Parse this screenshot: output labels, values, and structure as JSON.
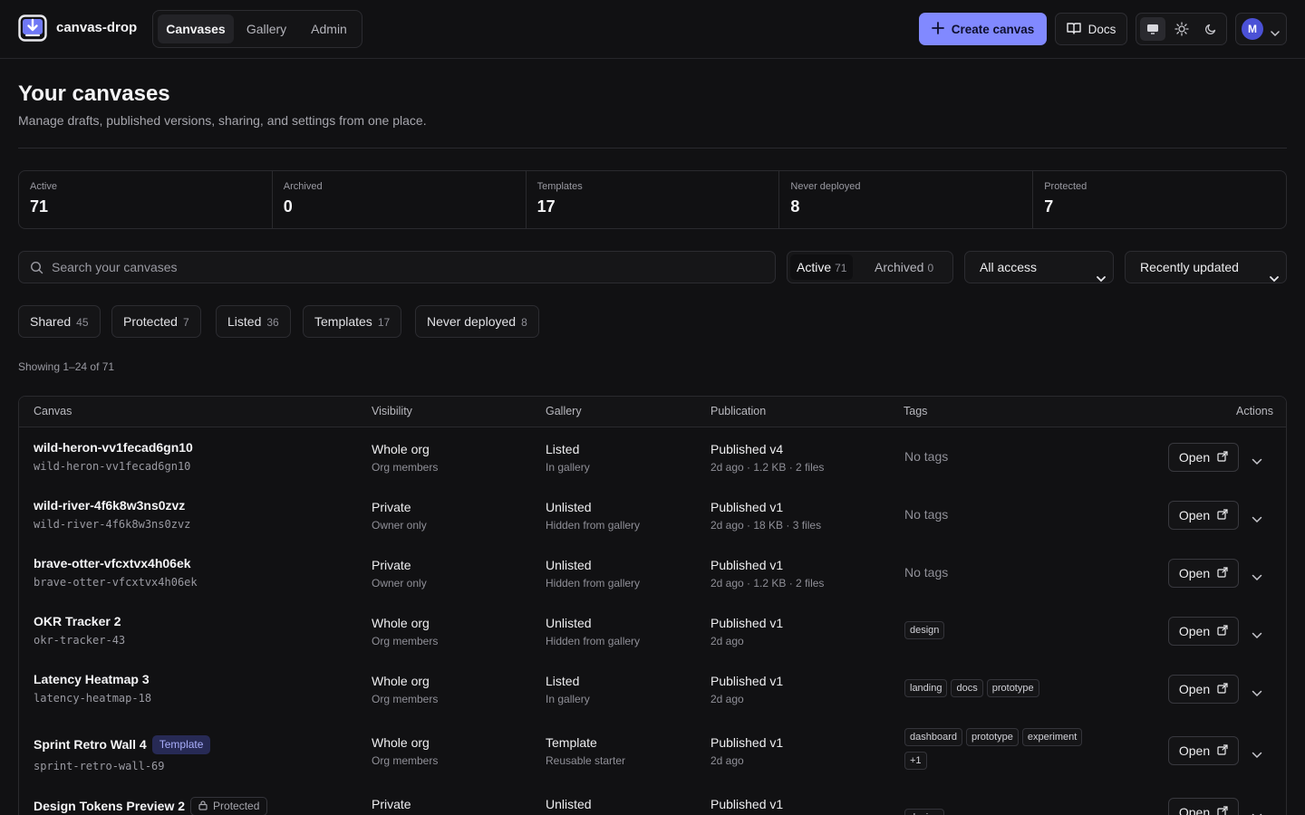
{
  "app": {
    "brand": "canvas-drop",
    "nav": [
      "Canvases",
      "Gallery",
      "Admin"
    ],
    "create_label": "Create canvas",
    "docs_label": "Docs",
    "avatar_initial": "M",
    "accent": "#8189ff"
  },
  "header": {
    "title": "Your canvases",
    "subtitle": "Manage drafts, published versions, sharing, and settings from one place."
  },
  "stats": [
    {
      "label": "Active",
      "value": "71"
    },
    {
      "label": "Archived",
      "value": "0"
    },
    {
      "label": "Templates",
      "value": "17"
    },
    {
      "label": "Never deployed",
      "value": "8"
    },
    {
      "label": "Protected",
      "value": "7"
    }
  ],
  "filters": {
    "search_placeholder": "Search your canvases",
    "status": [
      {
        "label": "Active",
        "count": "71"
      },
      {
        "label": "Archived",
        "count": "0"
      }
    ],
    "access": "All access",
    "sort": "Recently updated",
    "chips": [
      {
        "label": "Shared",
        "count": "45"
      },
      {
        "label": "Protected",
        "count": "7"
      },
      {
        "label": "Listed",
        "count": "36"
      },
      {
        "label": "Templates",
        "count": "17"
      },
      {
        "label": "Never deployed",
        "count": "8"
      }
    ],
    "showing": "Showing 1–24 of 71"
  },
  "table": {
    "columns": [
      "Canvas",
      "Visibility",
      "Gallery",
      "Publication",
      "Tags",
      "Actions"
    ],
    "open_label": "Open",
    "no_tags": "No tags",
    "template_badge": "Template",
    "protected_badge": "Protected",
    "rows": [
      {
        "name": "wild-heron-vv1fecad6gn10",
        "slug": "wild-heron-vv1fecad6gn10",
        "visibility": "Whole org",
        "visibility_sub": "Org members",
        "gallery": "Listed",
        "gallery_sub": "In gallery",
        "publication": "Published v4",
        "publication_sub": "2d ago · 1.2 KB · 2 files",
        "tags": []
      },
      {
        "name": "wild-river-4f6k8w3ns0zvz",
        "slug": "wild-river-4f6k8w3ns0zvz",
        "visibility": "Private",
        "visibility_sub": "Owner only",
        "gallery": "Unlisted",
        "gallery_sub": "Hidden from gallery",
        "publication": "Published v1",
        "publication_sub": "2d ago · 18 KB · 3 files",
        "tags": []
      },
      {
        "name": "brave-otter-vfcxtvx4h06ek",
        "slug": "brave-otter-vfcxtvx4h06ek",
        "visibility": "Private",
        "visibility_sub": "Owner only",
        "gallery": "Unlisted",
        "gallery_sub": "Hidden from gallery",
        "publication": "Published v1",
        "publication_sub": "2d ago · 1.2 KB · 2 files",
        "tags": []
      },
      {
        "name": "OKR Tracker 2",
        "slug": "okr-tracker-43",
        "visibility": "Whole org",
        "visibility_sub": "Org members",
        "gallery": "Unlisted",
        "gallery_sub": "Hidden from gallery",
        "publication": "Published v1",
        "publication_sub": "2d ago",
        "tags": [
          "design"
        ]
      },
      {
        "name": "Latency Heatmap 3",
        "slug": "latency-heatmap-18",
        "visibility": "Whole org",
        "visibility_sub": "Org members",
        "gallery": "Listed",
        "gallery_sub": "In gallery",
        "publication": "Published v1",
        "publication_sub": "2d ago",
        "tags": [
          "landing",
          "docs",
          "prototype"
        ]
      },
      {
        "name": "Sprint Retro Wall 4",
        "slug": "sprint-retro-wall-69",
        "visibility": "Whole org",
        "visibility_sub": "Org members",
        "gallery": "Template",
        "gallery_sub": "Reusable starter",
        "publication": "Published v1",
        "publication_sub": "2d ago",
        "tags": [
          "dashboard",
          "prototype",
          "experiment"
        ],
        "tags_more": "+1",
        "badge": "template"
      },
      {
        "name": "Design Tokens Preview 2",
        "slug": "",
        "visibility": "Private",
        "visibility_sub": "",
        "gallery": "Unlisted",
        "gallery_sub": "",
        "publication": "Published v1",
        "publication_sub": "",
        "tags": [
          "design"
        ],
        "badge": "protected"
      }
    ]
  }
}
